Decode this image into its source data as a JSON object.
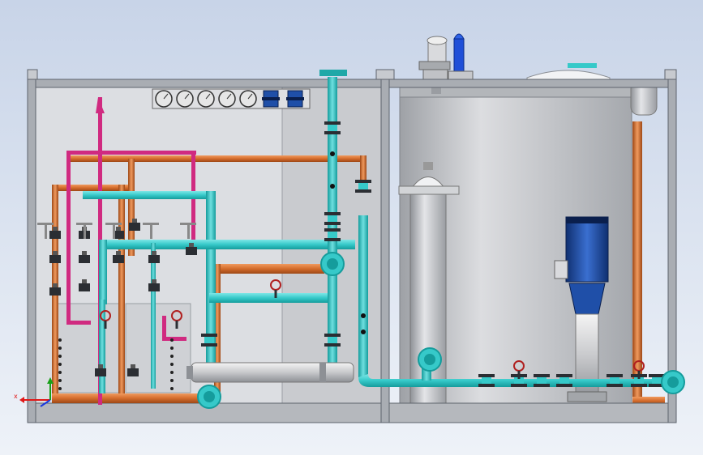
{
  "view": {
    "title": "",
    "background_top": "#c8d4e8",
    "background_bottom": "#eef2f8",
    "colors": {
      "frame": "#8a9099",
      "frame_dark": "#5d636c",
      "panel": "#c9cbcf",
      "tank": "#c4c6ca",
      "cyan_pipe": "#36c9c9",
      "cyan_dark": "#159c9c",
      "orange_pipe": "#d46c2c",
      "orange_dark": "#9e4816",
      "magenta_pipe": "#d02a80",
      "pump_motor": "#1f4fa8",
      "valve_dark": "#2b2e33",
      "gauge_face": "#e6e6e6"
    },
    "icons": {
      "gauges": "pressure-gauge-icon",
      "valve": "hand-wheel-valve-icon",
      "pump": "centrifugal-pump-icon",
      "tank": "storage-tank-icon",
      "axis_triad": "xyz-axis-triad-icon"
    }
  },
  "legend_text": "",
  "footer_note": ""
}
